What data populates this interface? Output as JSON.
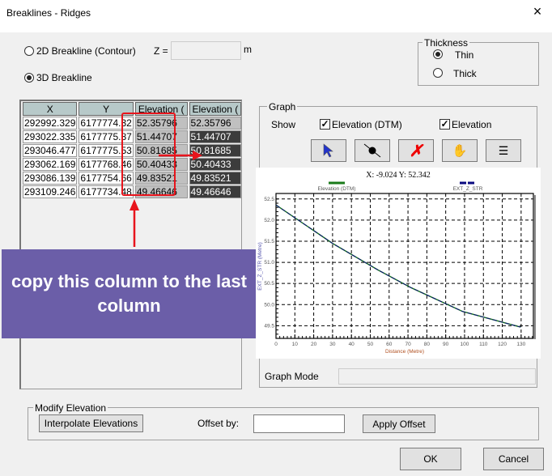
{
  "window": {
    "title": "Breaklines - Ridges",
    "close_icon": "×"
  },
  "mode": {
    "opt_2d": "2D Breakline (Contour)",
    "opt_3d": "3D Breakline",
    "selected": "3D Breakline",
    "z_label": "Z =",
    "z_value": "",
    "z_unit": "m"
  },
  "thickness": {
    "label": "Thickness",
    "thin": "Thin",
    "thick": "Thick",
    "selected": "Thin"
  },
  "table": {
    "headers": [
      "X",
      "Y",
      "Elevation (",
      "Elevation ("
    ],
    "rows": [
      [
        "292992.329",
        "6177774.32",
        "52.35796",
        "52.35796"
      ],
      [
        "293022.335",
        "6177775.87",
        "51.44707",
        "51.44707"
      ],
      [
        "293046.477",
        "6177775.53",
        "50.81685",
        "50.81685"
      ],
      [
        "293062.169",
        "6177768.46",
        "50.40433",
        "50.40433"
      ],
      [
        "293086.139",
        "6177754.66",
        "49.83521",
        "49.83521"
      ],
      [
        "293109.246",
        "6177734.48",
        "49.46646",
        "49.46646"
      ]
    ]
  },
  "annotation": {
    "text": "copy this column to the last column",
    "color": "#6b5ea8",
    "highlight_color": "#e8141c"
  },
  "graph": {
    "label": "Graph",
    "show_label": "Show",
    "show_dtm": {
      "label": "Elevation (DTM)",
      "checked": true
    },
    "show_elev": {
      "label": "Elevation",
      "checked": true
    },
    "tools": [
      "select-arrow",
      "point",
      "delete",
      "pan-hand",
      "list"
    ],
    "mode_label": "Graph Mode",
    "mode_value": ""
  },
  "chart_data": {
    "type": "line",
    "title": "X: -9.024 Y: 52.342",
    "xlabel": "Distance (Metre)",
    "ylabel": "EXT_Z_STR (Metre)",
    "xlim": [
      0,
      136.5
    ],
    "ylim": [
      49.2,
      52.63
    ],
    "xticks": [
      0,
      10,
      20,
      30,
      40,
      50,
      60,
      70,
      80,
      90,
      100,
      110,
      120,
      130
    ],
    "yticks": [
      49.5,
      50.0,
      50.5,
      51.0,
      51.5,
      52.0,
      52.5
    ],
    "grid": true,
    "legend": "top",
    "series": [
      {
        "name": "Elevation (DTM)",
        "color": "#1a7a1a",
        "x": [
          0,
          30.05,
          54.19,
          71.4,
          99.06,
          129.74
        ],
        "y": [
          52.35796,
          51.44707,
          50.81685,
          50.40433,
          49.83521,
          49.46646
        ]
      },
      {
        "name": "EXT_Z_STR",
        "color": "#0a0a80",
        "x": [
          0,
          30.05,
          54.19,
          71.4,
          99.06,
          129.74
        ],
        "y": [
          52.35796,
          51.44707,
          50.81685,
          50.40433,
          49.83521,
          49.46646
        ]
      }
    ]
  },
  "modify": {
    "label": "Modify Elevation",
    "interpolate": "Interpolate Elevations",
    "offset_label": "Offset by:",
    "offset_value": "",
    "apply": "Apply Offset"
  },
  "footer": {
    "ok": "OK",
    "cancel": "Cancel"
  }
}
